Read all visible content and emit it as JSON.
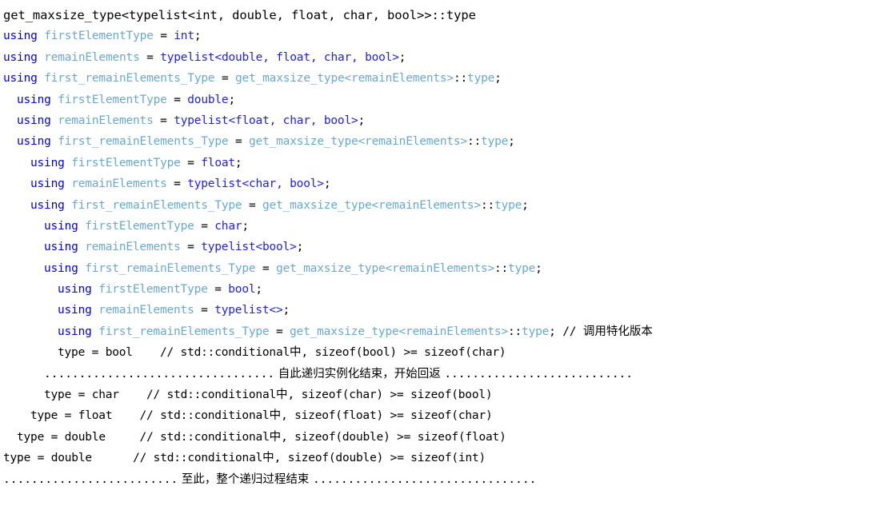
{
  "document": {
    "kind": "code-trace-listing",
    "language": "C++",
    "title": "get_maxsize_type<typelist<int, double, float, char, bool>>::type"
  },
  "colors": {
    "background": "#ffffff",
    "keyword": "#0000e0",
    "user_type": "#6aa9cf",
    "builtin_type": "#2222dd",
    "plain_text": "#000000",
    "comment": "#000000"
  },
  "lines": [
    {
      "id": "line-1",
      "indent": 0,
      "style": "header",
      "text": "get_maxsize_type<typelist<int, double, float, char, bool>>::type",
      "tokens": [
        {
          "t": "get_maxsize_type<typelist<int, double, float, char, bool>>::type",
          "c": "plain"
        }
      ]
    },
    {
      "id": "line-2",
      "indent": 0,
      "style": "code",
      "text": "using firstElementType = int;",
      "tokens": [
        {
          "t": "using",
          "c": "kw"
        },
        {
          "t": " ",
          "c": "plain"
        },
        {
          "t": "firstElementType",
          "c": "type"
        },
        {
          "t": " = ",
          "c": "plain"
        },
        {
          "t": "int",
          "c": "builtin"
        },
        {
          "t": ";",
          "c": "plain"
        }
      ]
    },
    {
      "id": "line-3",
      "indent": 0,
      "style": "code",
      "text": "using remainElements = typelist<double, float, char, bool>;",
      "tokens": [
        {
          "t": "using",
          "c": "kw"
        },
        {
          "t": " ",
          "c": "plain"
        },
        {
          "t": "remainElements",
          "c": "type"
        },
        {
          "t": " = ",
          "c": "plain"
        },
        {
          "t": "typelist<double, float, char, bool>",
          "c": "builtin"
        },
        {
          "t": ";",
          "c": "plain"
        }
      ]
    },
    {
      "id": "line-4",
      "indent": 0,
      "style": "code",
      "text": "using first_remainElements_Type = get_maxsize_type<remainElements>::type;",
      "tokens": [
        {
          "t": "using",
          "c": "kw"
        },
        {
          "t": " ",
          "c": "plain"
        },
        {
          "t": "first_remainElements_Type",
          "c": "type"
        },
        {
          "t": " = ",
          "c": "plain"
        },
        {
          "t": "get_maxsize_type<remainElements>",
          "c": "type"
        },
        {
          "t": "::",
          "c": "plain"
        },
        {
          "t": "type",
          "c": "type"
        },
        {
          "t": ";",
          "c": "plain"
        }
      ]
    },
    {
      "id": "line-5",
      "indent": 1,
      "style": "code",
      "text": "using firstElementType = double;",
      "tokens": [
        {
          "t": "using",
          "c": "kw"
        },
        {
          "t": " ",
          "c": "plain"
        },
        {
          "t": "firstElementType",
          "c": "type"
        },
        {
          "t": " = ",
          "c": "plain"
        },
        {
          "t": "double",
          "c": "builtin"
        },
        {
          "t": ";",
          "c": "plain"
        }
      ]
    },
    {
      "id": "line-6",
      "indent": 1,
      "style": "code",
      "text": "using remainElements = typelist<float, char, bool>;",
      "tokens": [
        {
          "t": "using",
          "c": "kw"
        },
        {
          "t": " ",
          "c": "plain"
        },
        {
          "t": "remainElements",
          "c": "type"
        },
        {
          "t": " = ",
          "c": "plain"
        },
        {
          "t": "typelist<float, char, bool>",
          "c": "builtin"
        },
        {
          "t": ";",
          "c": "plain"
        }
      ]
    },
    {
      "id": "line-7",
      "indent": 1,
      "style": "code",
      "text": "using first_remainElements_Type = get_maxsize_type<remainElements>::type;",
      "tokens": [
        {
          "t": "using",
          "c": "kw"
        },
        {
          "t": " ",
          "c": "plain"
        },
        {
          "t": "first_remainElements_Type",
          "c": "type"
        },
        {
          "t": " = ",
          "c": "plain"
        },
        {
          "t": "get_maxsize_type<remainElements>",
          "c": "type"
        },
        {
          "t": "::",
          "c": "plain"
        },
        {
          "t": "type",
          "c": "type"
        },
        {
          "t": ";",
          "c": "plain"
        }
      ]
    },
    {
      "id": "line-8",
      "indent": 2,
      "style": "code",
      "text": "using firstElementType = float;",
      "tokens": [
        {
          "t": "using",
          "c": "kw"
        },
        {
          "t": " ",
          "c": "plain"
        },
        {
          "t": "firstElementType",
          "c": "type"
        },
        {
          "t": " = ",
          "c": "plain"
        },
        {
          "t": "float",
          "c": "builtin"
        },
        {
          "t": ";",
          "c": "plain"
        }
      ]
    },
    {
      "id": "line-9",
      "indent": 2,
      "style": "code",
      "text": "using remainElements = typelist<char, bool>;",
      "tokens": [
        {
          "t": "using",
          "c": "kw"
        },
        {
          "t": " ",
          "c": "plain"
        },
        {
          "t": "remainElements",
          "c": "type"
        },
        {
          "t": " = ",
          "c": "plain"
        },
        {
          "t": "typelist<char, bool>",
          "c": "builtin"
        },
        {
          "t": ";",
          "c": "plain"
        }
      ]
    },
    {
      "id": "line-10",
      "indent": 2,
      "style": "code",
      "text": "using first_remainElements_Type = get_maxsize_type<remainElements>::type;",
      "tokens": [
        {
          "t": "using",
          "c": "kw"
        },
        {
          "t": " ",
          "c": "plain"
        },
        {
          "t": "first_remainElements_Type",
          "c": "type"
        },
        {
          "t": " = ",
          "c": "plain"
        },
        {
          "t": "get_maxsize_type<remainElements>",
          "c": "type"
        },
        {
          "t": "::",
          "c": "plain"
        },
        {
          "t": "type",
          "c": "type"
        },
        {
          "t": ";",
          "c": "plain"
        }
      ]
    },
    {
      "id": "line-11",
      "indent": 3,
      "style": "code",
      "text": "using firstElementType = char;",
      "tokens": [
        {
          "t": "using",
          "c": "kw"
        },
        {
          "t": " ",
          "c": "plain"
        },
        {
          "t": "firstElementType",
          "c": "type"
        },
        {
          "t": " = ",
          "c": "plain"
        },
        {
          "t": "char",
          "c": "builtin"
        },
        {
          "t": ";",
          "c": "plain"
        }
      ]
    },
    {
      "id": "line-12",
      "indent": 3,
      "style": "code",
      "text": "using remainElements = typelist<bool>;",
      "tokens": [
        {
          "t": "using",
          "c": "kw"
        },
        {
          "t": " ",
          "c": "plain"
        },
        {
          "t": "remainElements",
          "c": "type"
        },
        {
          "t": " = ",
          "c": "plain"
        },
        {
          "t": "typelist<bool>",
          "c": "builtin"
        },
        {
          "t": ";",
          "c": "plain"
        }
      ]
    },
    {
      "id": "line-13",
      "indent": 3,
      "style": "code",
      "text": "using first_remainElements_Type = get_maxsize_type<remainElements>::type;",
      "tokens": [
        {
          "t": "using",
          "c": "kw"
        },
        {
          "t": " ",
          "c": "plain"
        },
        {
          "t": "first_remainElements_Type",
          "c": "type"
        },
        {
          "t": " = ",
          "c": "plain"
        },
        {
          "t": "get_maxsize_type<remainElements>",
          "c": "type"
        },
        {
          "t": "::",
          "c": "plain"
        },
        {
          "t": "type",
          "c": "type"
        },
        {
          "t": ";",
          "c": "plain"
        }
      ]
    },
    {
      "id": "line-14",
      "indent": 4,
      "style": "code",
      "text": "using firstElementType = bool;",
      "tokens": [
        {
          "t": "using",
          "c": "kw"
        },
        {
          "t": " ",
          "c": "plain"
        },
        {
          "t": "firstElementType",
          "c": "type"
        },
        {
          "t": " = ",
          "c": "plain"
        },
        {
          "t": "bool",
          "c": "builtin"
        },
        {
          "t": ";",
          "c": "plain"
        }
      ]
    },
    {
      "id": "line-15",
      "indent": 4,
      "style": "code",
      "text": "using remainElements = typelist<>;",
      "tokens": [
        {
          "t": "using",
          "c": "kw"
        },
        {
          "t": " ",
          "c": "plain"
        },
        {
          "t": "remainElements",
          "c": "type"
        },
        {
          "t": " = ",
          "c": "plain"
        },
        {
          "t": "typelist<>",
          "c": "builtin"
        },
        {
          "t": ";",
          "c": "plain"
        }
      ]
    },
    {
      "id": "line-16",
      "indent": 4,
      "style": "code",
      "text": "using first_remainElements_Type = get_maxsize_type<remainElements>::type; // 调用特化版本",
      "tokens": [
        {
          "t": "using",
          "c": "kw"
        },
        {
          "t": " ",
          "c": "plain"
        },
        {
          "t": "first_remainElements_Type",
          "c": "type"
        },
        {
          "t": " = ",
          "c": "plain"
        },
        {
          "t": "get_maxsize_type<remainElements>",
          "c": "type"
        },
        {
          "t": "::",
          "c": "plain"
        },
        {
          "t": "type",
          "c": "type"
        },
        {
          "t": "; ",
          "c": "plain"
        },
        {
          "t": "// ",
          "c": "comment"
        },
        {
          "t": "调用特化版本",
          "c": "comment-cjk"
        }
      ]
    },
    {
      "id": "line-17",
      "indent": 4,
      "style": "code",
      "text": "type = bool    // std::conditional中, sizeof(bool) >= sizeof(char)",
      "tokens": [
        {
          "t": "type = bool    ",
          "c": "plain"
        },
        {
          "t": "// std::conditional",
          "c": "comment"
        },
        {
          "t": "中",
          "c": "comment-cjk"
        },
        {
          "t": ", sizeof(bool) >= sizeof(char)",
          "c": "comment"
        }
      ]
    },
    {
      "id": "line-18",
      "indent": 3,
      "style": "dots",
      "text": "................................. 自此递归实例化结束，开始回返 ...........................",
      "tokens": [
        {
          "t": ".................................",
          "c": "plain"
        },
        {
          "t": " 自此递归实例化结束，开始回返 ",
          "c": "comment-cjk"
        },
        {
          "t": "...........................",
          "c": "plain"
        }
      ]
    },
    {
      "id": "line-19",
      "indent": 3,
      "style": "code",
      "text": "type = char    // std::conditional中, sizeof(char) >= sizeof(bool)",
      "tokens": [
        {
          "t": "type = char    ",
          "c": "plain"
        },
        {
          "t": "// std::conditional",
          "c": "comment"
        },
        {
          "t": "中",
          "c": "comment-cjk"
        },
        {
          "t": ", sizeof(char) >= sizeof(bool)",
          "c": "comment"
        }
      ]
    },
    {
      "id": "line-20",
      "indent": 2,
      "style": "code",
      "text": "type = float    // std::conditional中, sizeof(float) >= sizeof(char)",
      "tokens": [
        {
          "t": "type = float    ",
          "c": "plain"
        },
        {
          "t": "// std::conditional",
          "c": "comment"
        },
        {
          "t": "中",
          "c": "comment-cjk"
        },
        {
          "t": ", sizeof(float) >= sizeof(char)",
          "c": "comment"
        }
      ]
    },
    {
      "id": "line-21",
      "indent": 1,
      "style": "code",
      "text": "type = double     // std::conditional中, sizeof(double) >= sizeof(float)",
      "tokens": [
        {
          "t": "type = double     ",
          "c": "plain"
        },
        {
          "t": "// std::conditional",
          "c": "comment"
        },
        {
          "t": "中",
          "c": "comment-cjk"
        },
        {
          "t": ", sizeof(double) >= sizeof(float)",
          "c": "comment"
        }
      ]
    },
    {
      "id": "line-22",
      "indent": 0,
      "style": "code",
      "text": "type = double      // std::conditional中, sizeof(double) >= sizeof(int)",
      "tokens": [
        {
          "t": "type = double      ",
          "c": "plain"
        },
        {
          "t": "// std::conditional",
          "c": "comment"
        },
        {
          "t": "中",
          "c": "comment-cjk"
        },
        {
          "t": ", sizeof(double) >= sizeof(int)",
          "c": "comment"
        }
      ]
    },
    {
      "id": "line-23",
      "indent": 0,
      "style": "dots",
      "text": "......................... 至此，整个递归过程结束 ................................",
      "tokens": [
        {
          "t": ".........................",
          "c": "plain"
        },
        {
          "t": " 至此，整个递归过程结束 ",
          "c": "comment-cjk"
        },
        {
          "t": "................................",
          "c": "plain"
        }
      ]
    }
  ]
}
